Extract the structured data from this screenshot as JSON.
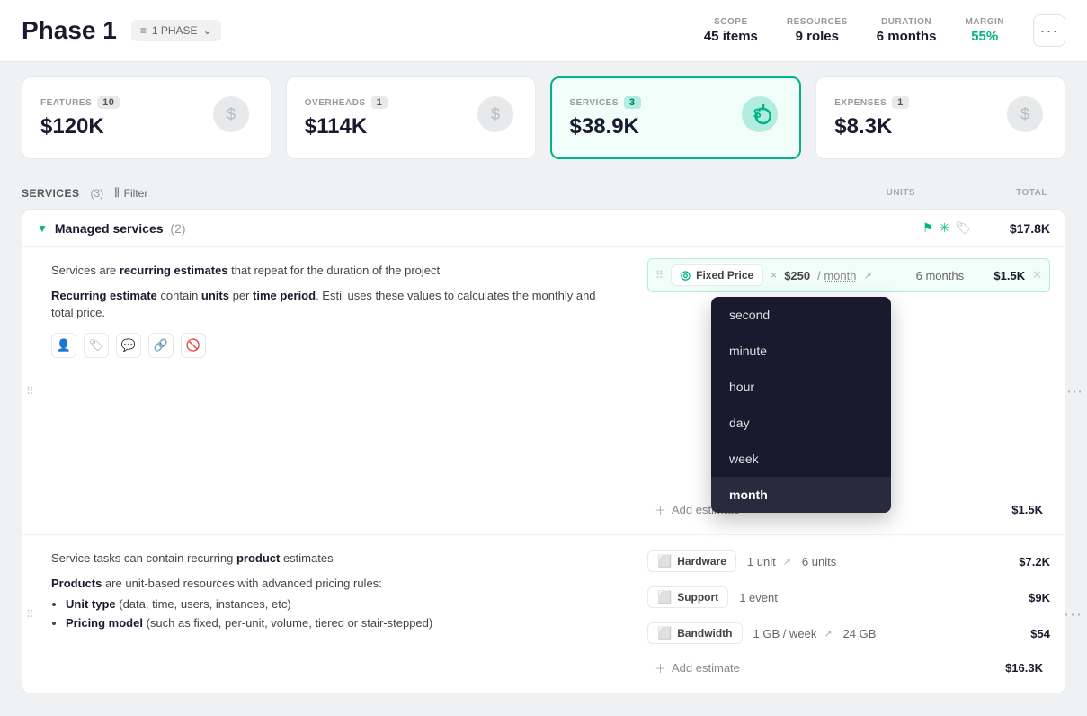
{
  "header": {
    "title": "Phase 1",
    "phase_badge": "1 PHASE",
    "scope_label": "SCOPE",
    "scope_value": "45 items",
    "resources_label": "RESOURCES",
    "resources_value": "9 roles",
    "duration_label": "DURATION",
    "duration_value": "6 months",
    "margin_label": "MARGIN",
    "margin_value": "55%",
    "more_icon": "···"
  },
  "cards": [
    {
      "type": "FEATURES",
      "count": "10",
      "amount": "$120K",
      "icon": "💲⚙"
    },
    {
      "type": "OVERHEADS",
      "count": "1",
      "amount": "$114K",
      "icon": "💲👤"
    },
    {
      "type": "SERVICES",
      "count": "3",
      "amount": "$38.9K",
      "icon": "💲🔄",
      "active": true
    },
    {
      "type": "EXPENSES",
      "count": "1",
      "amount": "$8.3K",
      "icon": "💲✏"
    }
  ],
  "services_section": {
    "title": "SERVICES",
    "count": "(3)",
    "filter_label": "Filter",
    "units_col": "UNITS",
    "total_col": "TOTAL"
  },
  "managed_services_group": {
    "name": "Managed services",
    "count": "(2)",
    "total": "$17.8K"
  },
  "service_row_1": {
    "desc_1": "Services are ",
    "desc_bold_1": "recurring estimates",
    "desc_2": " that repeat for the duration of the project",
    "desc_3": "Recurring estimate",
    "desc_4": " contain ",
    "desc_bold_2": "units",
    "desc_5": " per ",
    "desc_bold_3": "time period",
    "desc_6": ". Estii uses these values to calculates the monthly and total price.",
    "estimate_badge": "Fixed Price",
    "times": "×",
    "amount": "$250",
    "period": "/ month",
    "duration": "6 months",
    "total": "$1.5K",
    "add_estimate": "Add estimate",
    "add_estimate_total": "$1.5K"
  },
  "dropdown": {
    "items": [
      {
        "label": "second",
        "selected": false
      },
      {
        "label": "minute",
        "selected": false
      },
      {
        "label": "hour",
        "selected": false
      },
      {
        "label": "day",
        "selected": false
      },
      {
        "label": "week",
        "selected": false
      },
      {
        "label": "month",
        "selected": true
      }
    ]
  },
  "service_row_2": {
    "desc_1": "Service tasks can contain recurring ",
    "desc_bold_1": "product",
    "desc_2": " estimates",
    "desc_3": "Products",
    "desc_4": " are unit-based resources with advanced pricing rules:",
    "bullets": [
      {
        "bold": "Unit type",
        "text": " (data, time, users, instances, etc)"
      },
      {
        "bold": "Pricing model",
        "text": " (such as fixed, per-unit, volume, tiered or stair-stepped)"
      }
    ],
    "products": [
      {
        "name": "Hardware",
        "units": "1 unit",
        "duration": "6 units",
        "total": "$7.2K"
      },
      {
        "name": "Support",
        "units": "1 event",
        "duration": "",
        "total": "$9K"
      },
      {
        "name": "Bandwidth",
        "units": "1 GB / week",
        "duration": "24 GB",
        "total": "$54"
      }
    ],
    "add_estimate": "Add estimate",
    "add_estimate_total": "$16.3K"
  }
}
